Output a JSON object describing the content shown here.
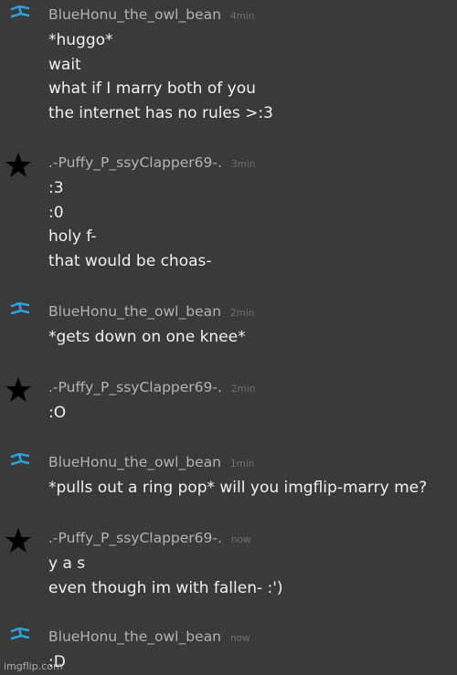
{
  "colors": {
    "background": "#3a3a3a",
    "username": "#b3b3b3",
    "timestamp": "#6f6f6f",
    "message_text": "#f0f0f0",
    "blue_icon": "#29a3e0"
  },
  "messages": [
    {
      "username": "BlueHonu_the_owl_bean",
      "time": "4min",
      "icon": "blue-flag-icon",
      "lines": [
        "*huggo*",
        "wait",
        "what if I marry both of you",
        "the internet has no rules >:3"
      ]
    },
    {
      "username": ".-Puffy_P_ssyClapper69-.",
      "time": "3min",
      "icon": "star-icon",
      "lines": [
        ":3",
        ":0",
        "holy f-",
        "that would be choas-"
      ]
    },
    {
      "username": "BlueHonu_the_owl_bean",
      "time": "2min",
      "icon": "blue-flag-icon",
      "lines": [
        "*gets down on one knee*"
      ]
    },
    {
      "username": ".-Puffy_P_ssyClapper69-.",
      "time": "2min",
      "icon": "star-icon",
      "lines": [
        ":O"
      ]
    },
    {
      "username": "BlueHonu_the_owl_bean",
      "time": "1min",
      "icon": "blue-flag-icon",
      "lines": [
        "*pulls out a ring pop* will you imgflip-marry me?"
      ]
    },
    {
      "username": ".-Puffy_P_ssyClapper69-.",
      "time": "now",
      "icon": "star-icon",
      "lines": [
        "y a s",
        "even though im with fallen- :')"
      ]
    },
    {
      "username": "BlueHonu_the_owl_bean",
      "time": "now",
      "icon": "blue-flag-icon",
      "lines": [
        ":D"
      ]
    }
  ],
  "watermark": "imgflip.com"
}
